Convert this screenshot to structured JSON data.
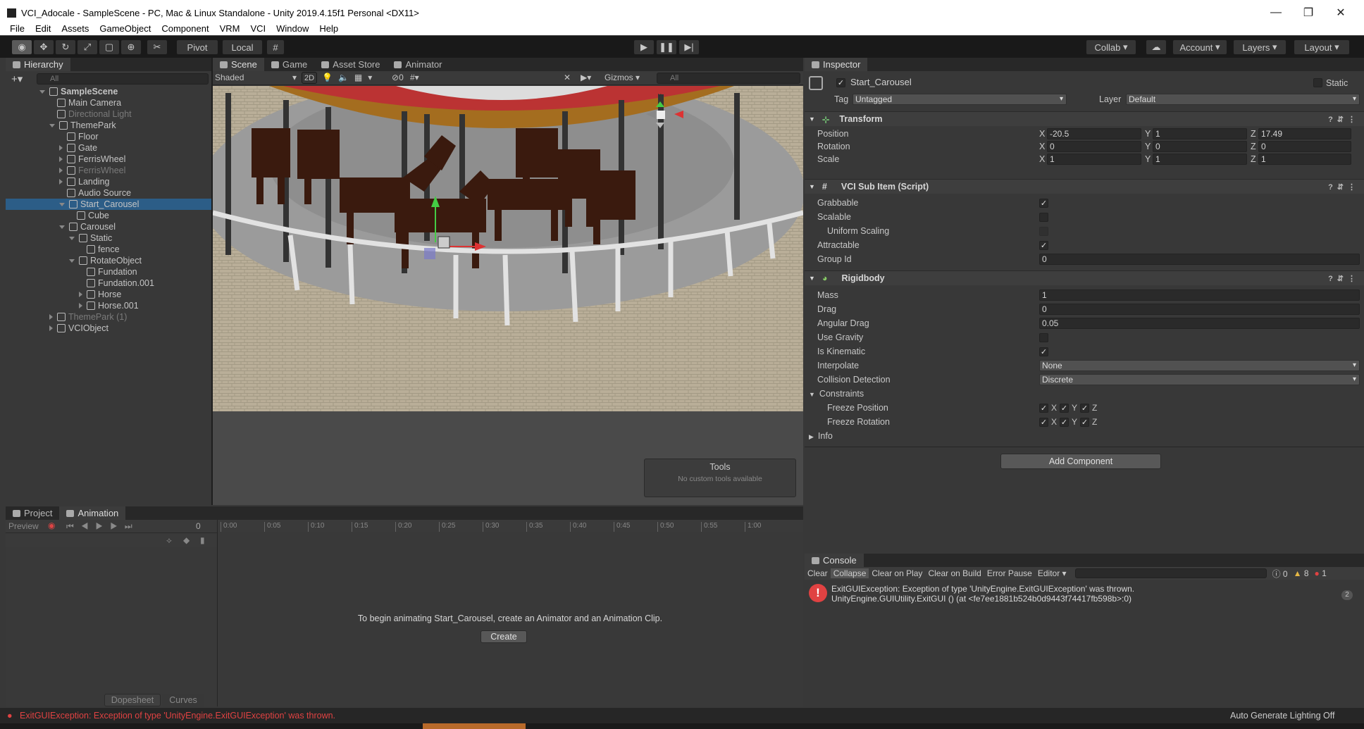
{
  "window": {
    "title": "VCI_Adocale - SampleScene - PC, Mac & Linux Standalone - Unity 2019.4.15f1 Personal <DX11>"
  },
  "menu": [
    "File",
    "Edit",
    "Assets",
    "GameObject",
    "Component",
    "VRM",
    "VCI",
    "Window",
    "Help"
  ],
  "toolbar": {
    "pivot": "Pivot",
    "local": "Local",
    "collab": "Collab",
    "account": "Account",
    "layers": "Layers",
    "layout": "Layout"
  },
  "hierarchy": {
    "tab": "Hierarchy",
    "search_placeholder": "All",
    "items": [
      {
        "label": "SampleScene",
        "depth": 0,
        "type": "scene",
        "expand": "open"
      },
      {
        "label": "Main Camera",
        "depth": 1,
        "expand": "none"
      },
      {
        "label": "Directional Light",
        "depth": 1,
        "expand": "none",
        "dim": true
      },
      {
        "label": "ThemePark",
        "depth": 1,
        "expand": "open"
      },
      {
        "label": "Floor",
        "depth": 2,
        "expand": "none"
      },
      {
        "label": "Gate",
        "depth": 2,
        "expand": "closed"
      },
      {
        "label": "FerrisWheel",
        "depth": 2,
        "expand": "closed"
      },
      {
        "label": "FerrisWheel",
        "depth": 2,
        "expand": "closed",
        "dim": true
      },
      {
        "label": "Landing",
        "depth": 2,
        "expand": "closed"
      },
      {
        "label": "Audio Source",
        "depth": 2,
        "expand": "none"
      },
      {
        "label": "Start_Carousel",
        "depth": 2,
        "expand": "open",
        "selected": true
      },
      {
        "label": "Cube",
        "depth": 3,
        "expand": "none"
      },
      {
        "label": "Carousel",
        "depth": 2,
        "expand": "open"
      },
      {
        "label": "Static",
        "depth": 3,
        "expand": "open"
      },
      {
        "label": "fence",
        "depth": 4,
        "expand": "none"
      },
      {
        "label": "RotateObject",
        "depth": 3,
        "expand": "open"
      },
      {
        "label": "Fundation",
        "depth": 4,
        "expand": "none"
      },
      {
        "label": "Fundation.001",
        "depth": 4,
        "expand": "none"
      },
      {
        "label": "Horse",
        "depth": 4,
        "expand": "closed"
      },
      {
        "label": "Horse.001",
        "depth": 4,
        "expand": "closed"
      },
      {
        "label": "ThemePark (1)",
        "depth": 1,
        "expand": "closed",
        "dim": true
      },
      {
        "label": "VCIObject",
        "depth": 1,
        "expand": "closed"
      }
    ]
  },
  "scene": {
    "tabs": [
      "Scene",
      "Game",
      "Asset Store",
      "Animator"
    ],
    "shading": "Shaded",
    "mode_2d": "2D",
    "hidden_count": "0",
    "gizmos": "Gizmos",
    "search_placeholder": "All",
    "tools_title": "Tools",
    "tools_msg": "No custom tools available"
  },
  "animation": {
    "tabs": [
      "Project",
      "Animation"
    ],
    "preview": "Preview",
    "frame": "0",
    "ticks": [
      "0:00",
      "0:05",
      "0:10",
      "0:15",
      "0:20",
      "0:25",
      "0:30",
      "0:35",
      "0:40",
      "0:45",
      "0:50",
      "0:55",
      "1:00"
    ],
    "message": "To begin animating Start_Carousel, create an Animator and an Animation Clip.",
    "create": "Create",
    "dopesheet": "Dopesheet",
    "curves": "Curves"
  },
  "inspector": {
    "tab": "Inspector",
    "object_name": "Start_Carousel",
    "static": "Static",
    "tag_label": "Tag",
    "tag": "Untagged",
    "layer_label": "Layer",
    "layer": "Default",
    "transform": {
      "title": "Transform",
      "rows": [
        {
          "label": "Position",
          "x": "-20.5",
          "y": "1",
          "z": "17.49"
        },
        {
          "label": "Rotation",
          "x": "0",
          "y": "0",
          "z": "0"
        },
        {
          "label": "Scale",
          "x": "1",
          "y": "1",
          "z": "1"
        }
      ]
    },
    "vci": {
      "title": "VCI Sub Item (Script)",
      "grabbable": "Grabbable",
      "scalable": "Scalable",
      "uniform": "Uniform Scaling",
      "attractable": "Attractable",
      "group_label": "Group Id",
      "group": "0"
    },
    "rigidbody": {
      "title": "Rigidbody",
      "mass_label": "Mass",
      "mass": "1",
      "drag_label": "Drag",
      "drag": "0",
      "adrag_label": "Angular Drag",
      "adrag": "0.05",
      "gravity_label": "Use Gravity",
      "kinematic_label": "Is Kinematic",
      "interp_label": "Interpolate",
      "interp": "None",
      "coll_label": "Collision Detection",
      "coll": "Discrete",
      "constraints": "Constraints",
      "fpos": "Freeze Position",
      "frot": "Freeze Rotation",
      "info": "Info"
    },
    "add_component": "Add Component"
  },
  "console": {
    "tab": "Console",
    "buttons": [
      "Clear",
      "Collapse",
      "Clear on Play",
      "Clear on Build",
      "Error Pause",
      "Editor"
    ],
    "counts": {
      "log": "0",
      "warn": "8",
      "err": "1"
    },
    "line1": "ExitGUIException: Exception of type 'UnityEngine.ExitGUIException' was thrown.",
    "line2": "UnityEngine.GUIUtility.ExitGUI () (at <fe7ee1881b524b0d9443f74417fb598b>:0)",
    "badge": "2"
  },
  "status": {
    "error": "ExitGUIException: Exception of type 'UnityEngine.ExitGUIException' was thrown.",
    "lighting": "Auto Generate Lighting Off"
  },
  "colors": {
    "selection": "#2c5d87",
    "error": "#e04242",
    "accent": "#d64a4a"
  }
}
